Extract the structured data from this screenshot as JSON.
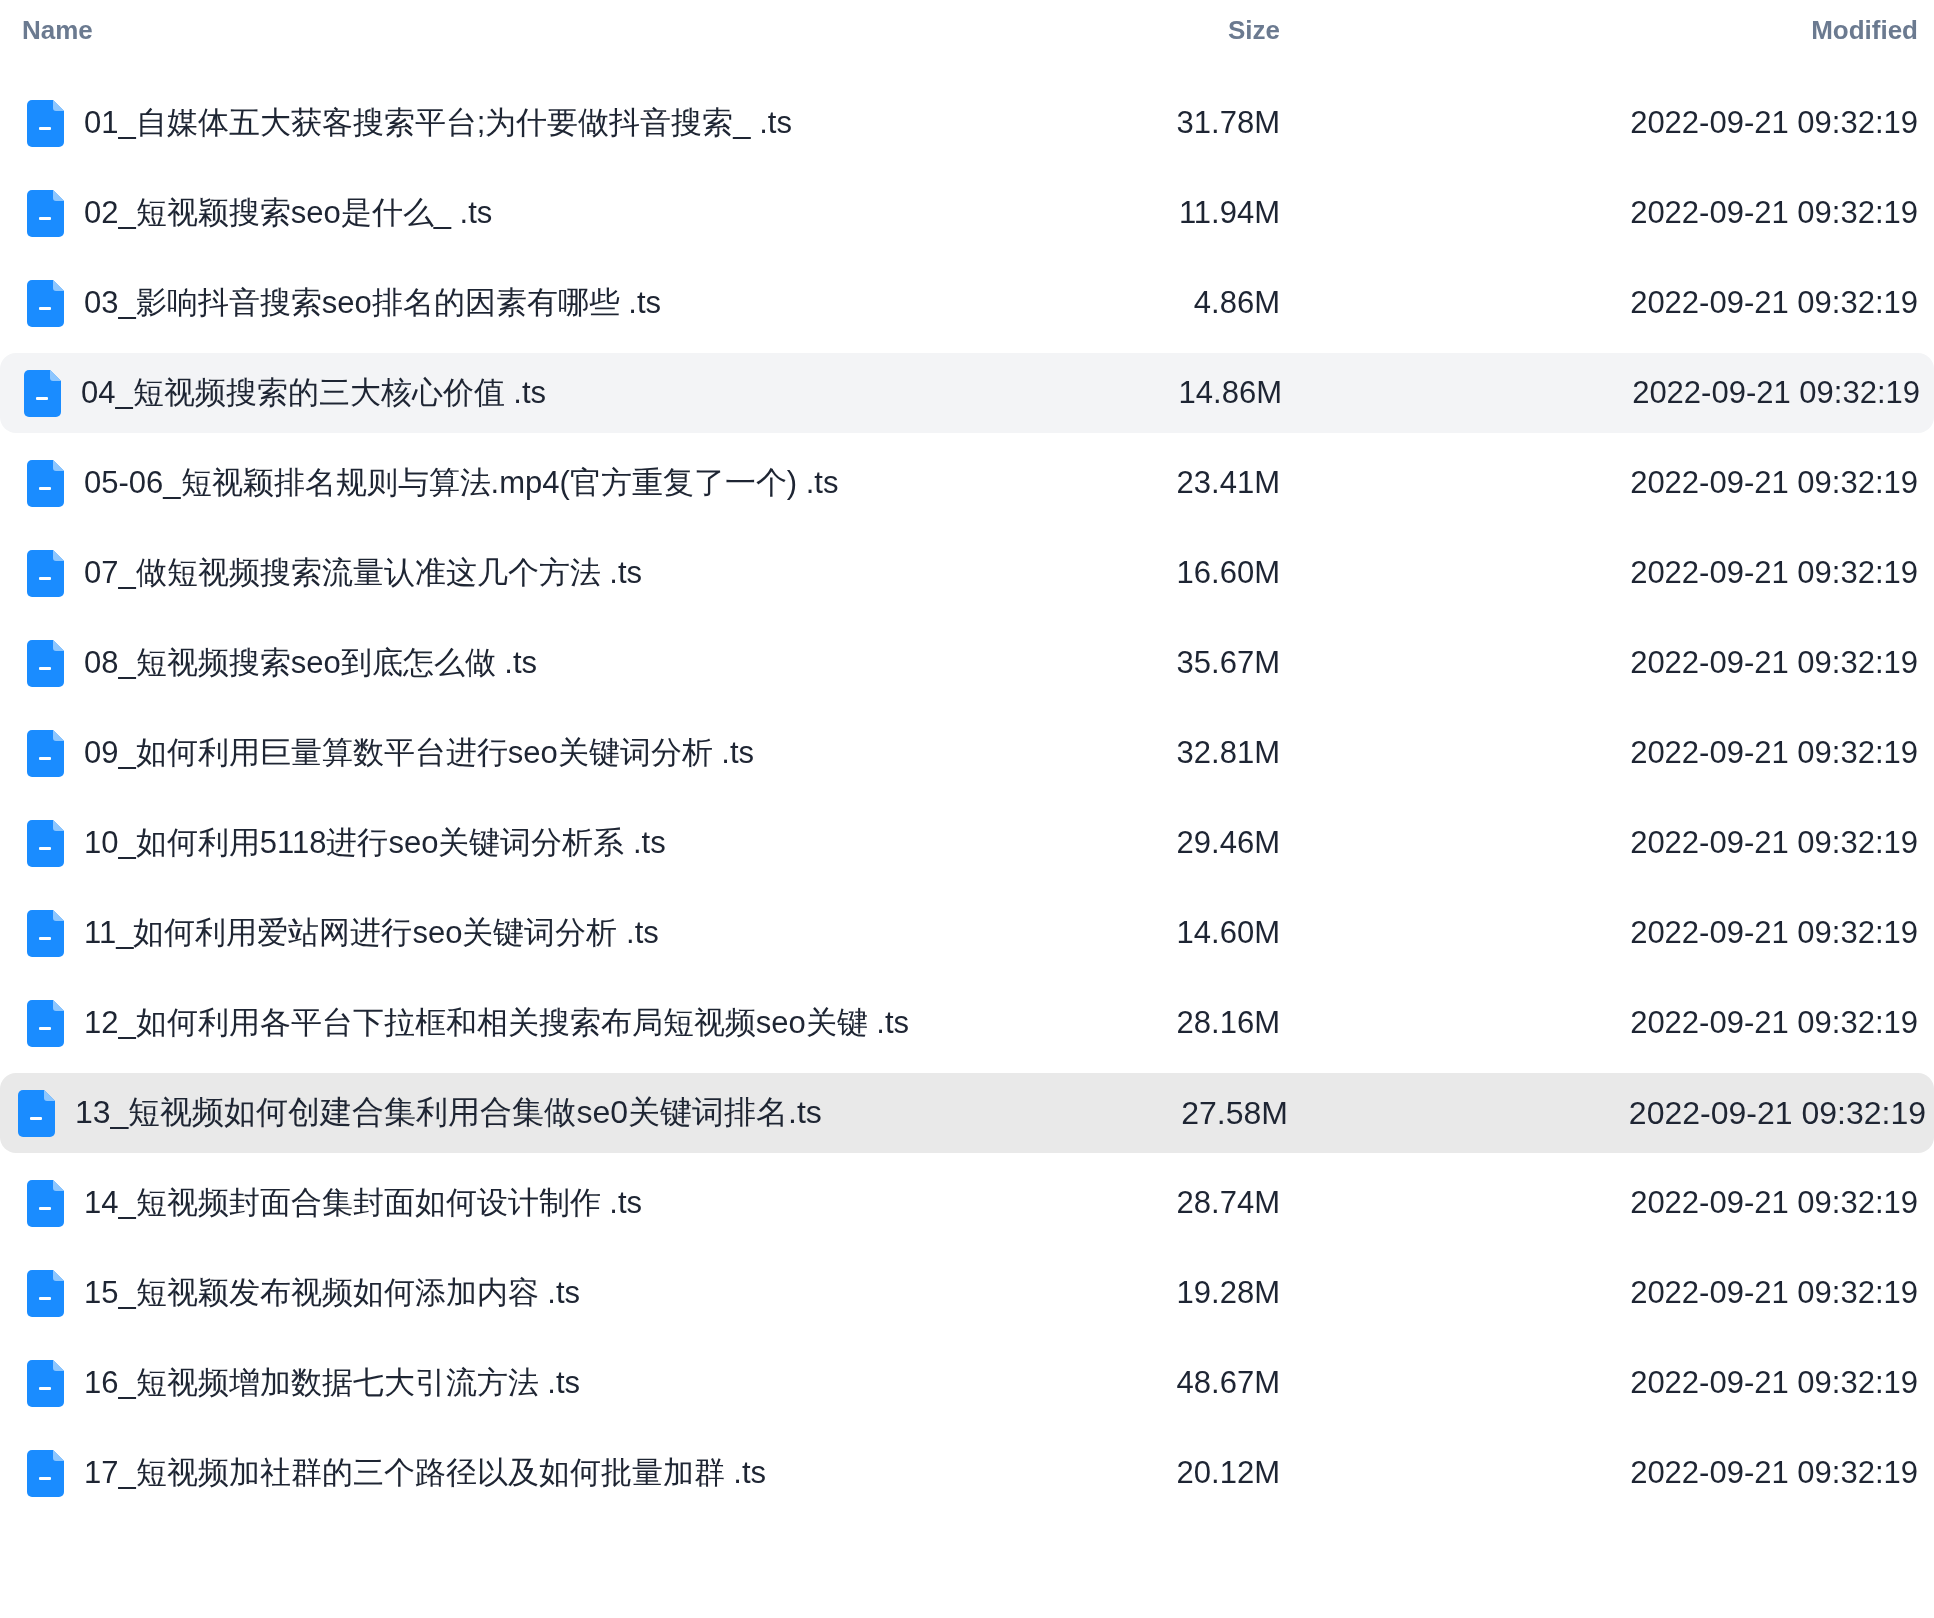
{
  "columns": [
    "Name",
    "Size",
    "Modified"
  ],
  "rows": [
    {
      "name": "01_自媒体五大获客搜索平台;为什要做抖音搜索_ .ts",
      "size": "31.78M",
      "modified": "2022-09-21 09:32:19",
      "hovered": false,
      "selected": false
    },
    {
      "name": "02_短视颖搜索seo是什么_ .ts",
      "size": "11.94M",
      "modified": "2022-09-21 09:32:19",
      "hovered": false,
      "selected": false
    },
    {
      "name": "03_影响抖音搜索seo排名的因素有哪些 .ts",
      "size": "4.86M",
      "modified": "2022-09-21 09:32:19",
      "hovered": false,
      "selected": false
    },
    {
      "name": "04_短视频搜索的三大核心价值 .ts",
      "size": "14.86M",
      "modified": "2022-09-21 09:32:19",
      "hovered": true,
      "selected": false
    },
    {
      "name": "05-06_短视颖排名规则与算法.mp4(官方重复了一个) .ts",
      "size": "23.41M",
      "modified": "2022-09-21 09:32:19",
      "hovered": false,
      "selected": false
    },
    {
      "name": "07_做短视频搜索流量认准这几个方法 .ts",
      "size": "16.60M",
      "modified": "2022-09-21 09:32:19",
      "hovered": false,
      "selected": false
    },
    {
      "name": "08_短视频搜索seo到底怎么做 .ts",
      "size": "35.67M",
      "modified": "2022-09-21 09:32:19",
      "hovered": false,
      "selected": false
    },
    {
      "name": "09_如何利用巨量算数平台进行seo关键词分析 .ts",
      "size": "32.81M",
      "modified": "2022-09-21 09:32:19",
      "hovered": false,
      "selected": false
    },
    {
      "name": "10_如何利用5118进行seo关键词分析系 .ts",
      "size": "29.46M",
      "modified": "2022-09-21 09:32:19",
      "hovered": false,
      "selected": false
    },
    {
      "name": "11_如何利用爱站网进行seo关键词分析 .ts",
      "size": "14.60M",
      "modified": "2022-09-21 09:32:19",
      "hovered": false,
      "selected": false
    },
    {
      "name": "12_如何利用各平台下拉框和相关搜索布局短视频seo关键 .ts",
      "size": "28.16M",
      "modified": "2022-09-21 09:32:19",
      "hovered": false,
      "selected": false
    },
    {
      "name": "13_短视频如何创建合集利用合集做se0关键词排名.ts",
      "size": "27.58M",
      "modified": "2022-09-21 09:32:19",
      "hovered": false,
      "selected": true
    },
    {
      "name": "14_短视频封面合集封面如何设计制作 .ts",
      "size": "28.74M",
      "modified": "2022-09-21 09:32:19",
      "hovered": false,
      "selected": false
    },
    {
      "name": "15_短视颖发布视频如何添加内容 .ts",
      "size": "19.28M",
      "modified": "2022-09-21 09:32:19",
      "hovered": false,
      "selected": false
    },
    {
      "name": "16_短视频增加数据七大引流方法 .ts",
      "size": "48.67M",
      "modified": "2022-09-21 09:32:19",
      "hovered": false,
      "selected": false
    },
    {
      "name": "17_短视频加社群的三个路径以及如何批量加群 .ts",
      "size": "20.12M",
      "modified": "2022-09-21 09:32:19",
      "hovered": false,
      "selected": false
    }
  ]
}
